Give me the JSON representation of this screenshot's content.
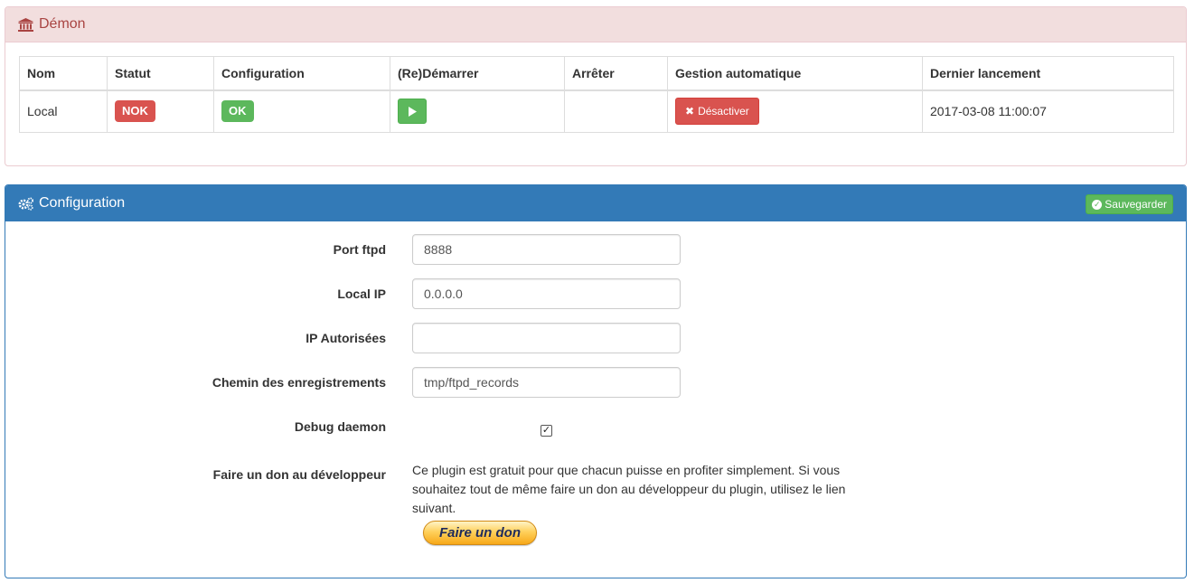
{
  "demon": {
    "title": "Démon",
    "title_icon": "bank-icon",
    "columns": [
      "Nom",
      "Statut",
      "Configuration",
      "(Re)Démarrer",
      "Arrêter",
      "Gestion automatique",
      "Dernier lancement"
    ],
    "row": {
      "nom": "Local",
      "statut": "NOK",
      "configuration": "OK",
      "auto_button": "Désactiver",
      "dernier_lancement": "2017-03-08 11:00:07"
    }
  },
  "config": {
    "title": "Configuration",
    "title_icon": "cogs-icon",
    "save_label": "Sauvegarder",
    "fields": {
      "port_label": "Port ftpd",
      "port_value": "8888",
      "local_ip_label": "Local IP",
      "local_ip_value": "0.0.0.0",
      "ip_auth_label": "IP Autorisées",
      "ip_auth_value": "",
      "records_label": "Chemin des enregistrements",
      "records_value": "tmp/ftpd_records",
      "debug_label": "Debug daemon",
      "debug_checked": true,
      "donate_label": "Faire un don au développeur",
      "donate_text": "Ce plugin est gratuit pour que chacun puisse en profiter simplement. Si vous souhaitez tout de même faire un don au développeur du plugin, utilisez le lien suivant.",
      "donate_button": "Faire un don"
    }
  },
  "colors": {
    "danger": "#d9534f",
    "success": "#5cb85c",
    "primary": "#337ab7",
    "danger_bg": "#f2dede",
    "danger_text": "#a94442"
  }
}
